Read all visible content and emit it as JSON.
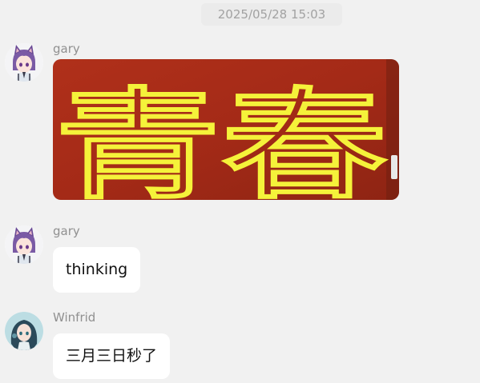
{
  "timestamp": "2025/05/28 15:03",
  "messages": [
    {
      "sender": "gary",
      "type": "image",
      "image_text": "青春",
      "image_colors": {
        "background": "#a42a17",
        "text": "#f5f23a"
      }
    },
    {
      "sender": "gary",
      "type": "text",
      "text": "thinking"
    },
    {
      "sender": "Winfrid",
      "type": "text",
      "text": "三月三日秒了"
    }
  ],
  "colors": {
    "page_background": "#f1f1f1",
    "bubble_background": "#ffffff",
    "sender_name": "#909090",
    "timestamp_text": "#a2a2a2"
  },
  "icons": [
    "anime-avatar-purple-cat-ears",
    "anime-avatar-teal-hair"
  ]
}
